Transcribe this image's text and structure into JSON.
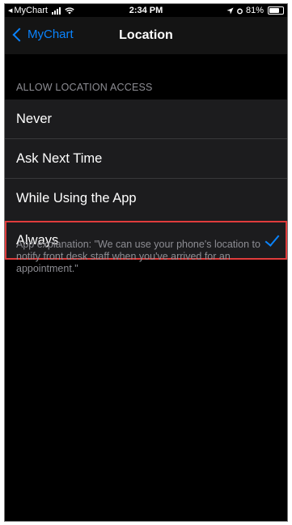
{
  "status_bar": {
    "back_app": "MyChart",
    "time": "2:34 PM",
    "battery": "81%"
  },
  "nav_bar": {
    "back_label": "MyChart",
    "title": "Location"
  },
  "section": {
    "header": "ALLOW LOCATION ACCESS",
    "options": [
      {
        "label": "Never",
        "selected": false
      },
      {
        "label": "Ask Next Time",
        "selected": false
      },
      {
        "label": "While Using the App",
        "selected": false
      },
      {
        "label": "Always",
        "selected": true
      }
    ],
    "footer": "App explanation: \"We can use your phone's location to notify front desk staff when you've arrived for an appointment.\""
  },
  "colors": {
    "accent": "#0a84ff",
    "highlight_border": "#e03c3c",
    "background": "#000000"
  }
}
